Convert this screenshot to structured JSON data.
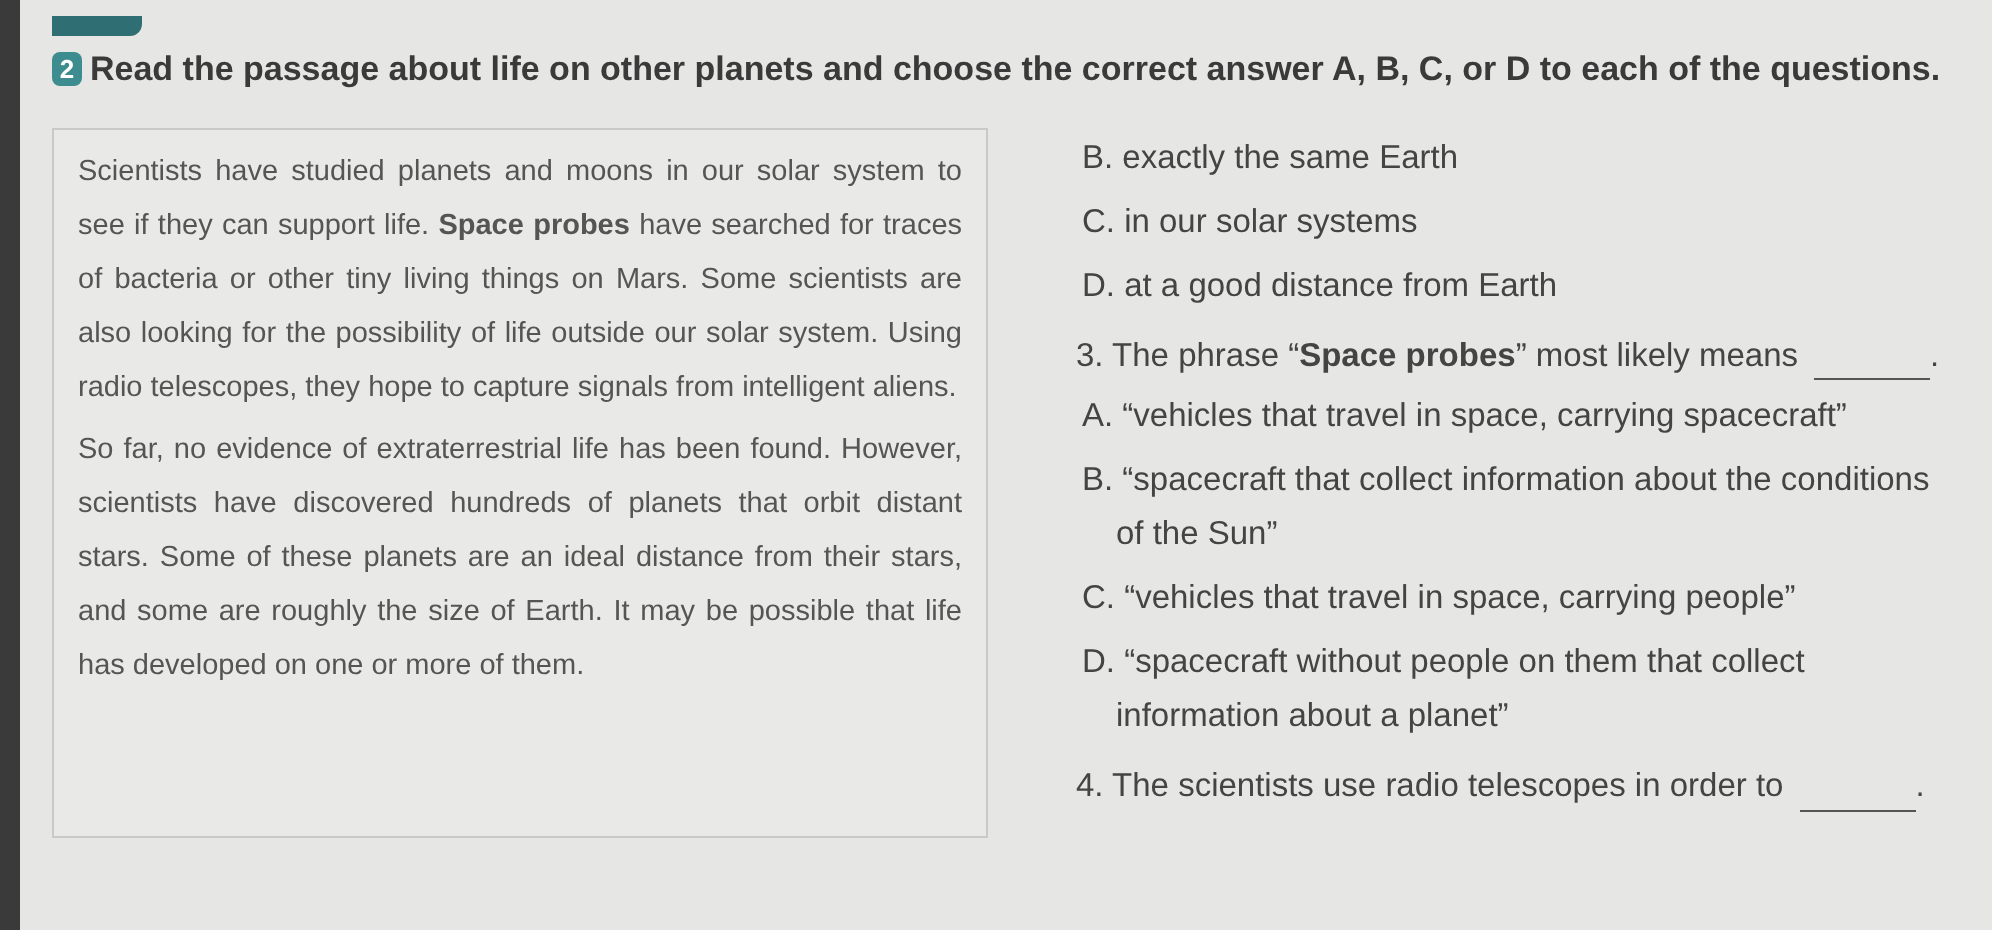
{
  "instruction": {
    "number": "2",
    "text": "Read the passage about life on other planets and choose the correct answer A, B, C, or D to each of the questions."
  },
  "passage": [
    "Scientists have studied planets and moons in our solar system to see if they can support life. **Space probes** have searched for traces of bacteria or other tiny living things on Mars. Some scientists are also looking for the possibility of life outside our solar system. Using radio telescopes, they hope to capture signals from intelligent aliens.",
    "So far, no evidence of extraterrestrial life has been found. However, scientists have discovered hundreds of planets that orbit distant stars. Some of these planets are an ideal distance from their stars, and some are roughly the size of Earth. It may be possible that life has developed on one or more of them."
  ],
  "questions_items": [
    {
      "kind": "option",
      "text": "B. exactly the same Earth"
    },
    {
      "kind": "option",
      "text": "C. in our solar systems"
    },
    {
      "kind": "option",
      "text": "D. at a good distance from Earth"
    },
    {
      "kind": "question",
      "text": "3. The phrase “**Space probes**” most likely means",
      "end": "."
    },
    {
      "kind": "option",
      "text": "A. “vehicles that travel in space, carrying spacecraft”"
    },
    {
      "kind": "option",
      "text": "B. “spacecraft that collect information about the conditions of the Sun”"
    },
    {
      "kind": "option",
      "text": "C. “vehicles that travel in space, carrying people”"
    },
    {
      "kind": "option",
      "text": "D. “spacecraft without people on them that collect information about a planet”"
    },
    {
      "kind": "question",
      "text": "4. The scientists use radio telescopes in order to",
      "end": "."
    }
  ]
}
